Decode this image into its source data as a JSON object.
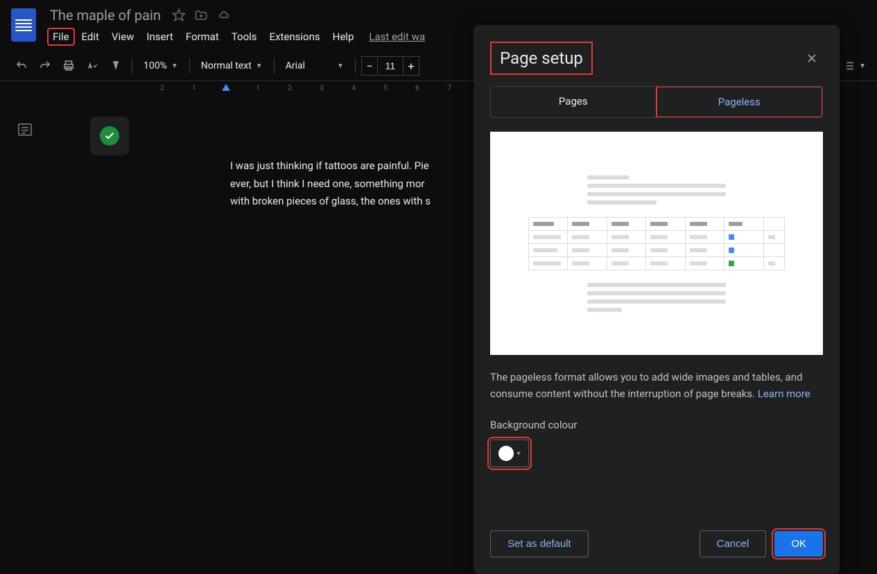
{
  "header": {
    "title": "The maple of pain",
    "menu": [
      "File",
      "Edit",
      "View",
      "Insert",
      "Format",
      "Tools",
      "Extensions",
      "Help"
    ],
    "last_edit": "Last edit wa"
  },
  "toolbar": {
    "zoom": "100%",
    "style": "Normal text",
    "font": "Arial",
    "font_size": "11"
  },
  "ruler": [
    "2",
    "1",
    "",
    "1",
    "2",
    "3",
    "4",
    "5",
    "6",
    "7"
  ],
  "document": {
    "text": "I was just thinking if tattoos are painful. Pie\never, but I think I need one, something mor\nwith broken pieces of glass, the ones with s"
  },
  "dialog": {
    "title": "Page setup",
    "tabs": {
      "pages": "Pages",
      "pageless": "Pageless"
    },
    "description": "The pageless format allows you to add wide images and tables, and consume content without the interruption of page breaks. ",
    "learn_more": "Learn more",
    "bg_label": "Background colour",
    "bg_color": "#ffffff",
    "set_default": "Set as default",
    "cancel": "Cancel",
    "ok": "OK"
  },
  "highlights": {
    "file_menu": true,
    "dialog_title": true,
    "pageless_tab": true,
    "color_picker": true,
    "ok_button": true
  }
}
